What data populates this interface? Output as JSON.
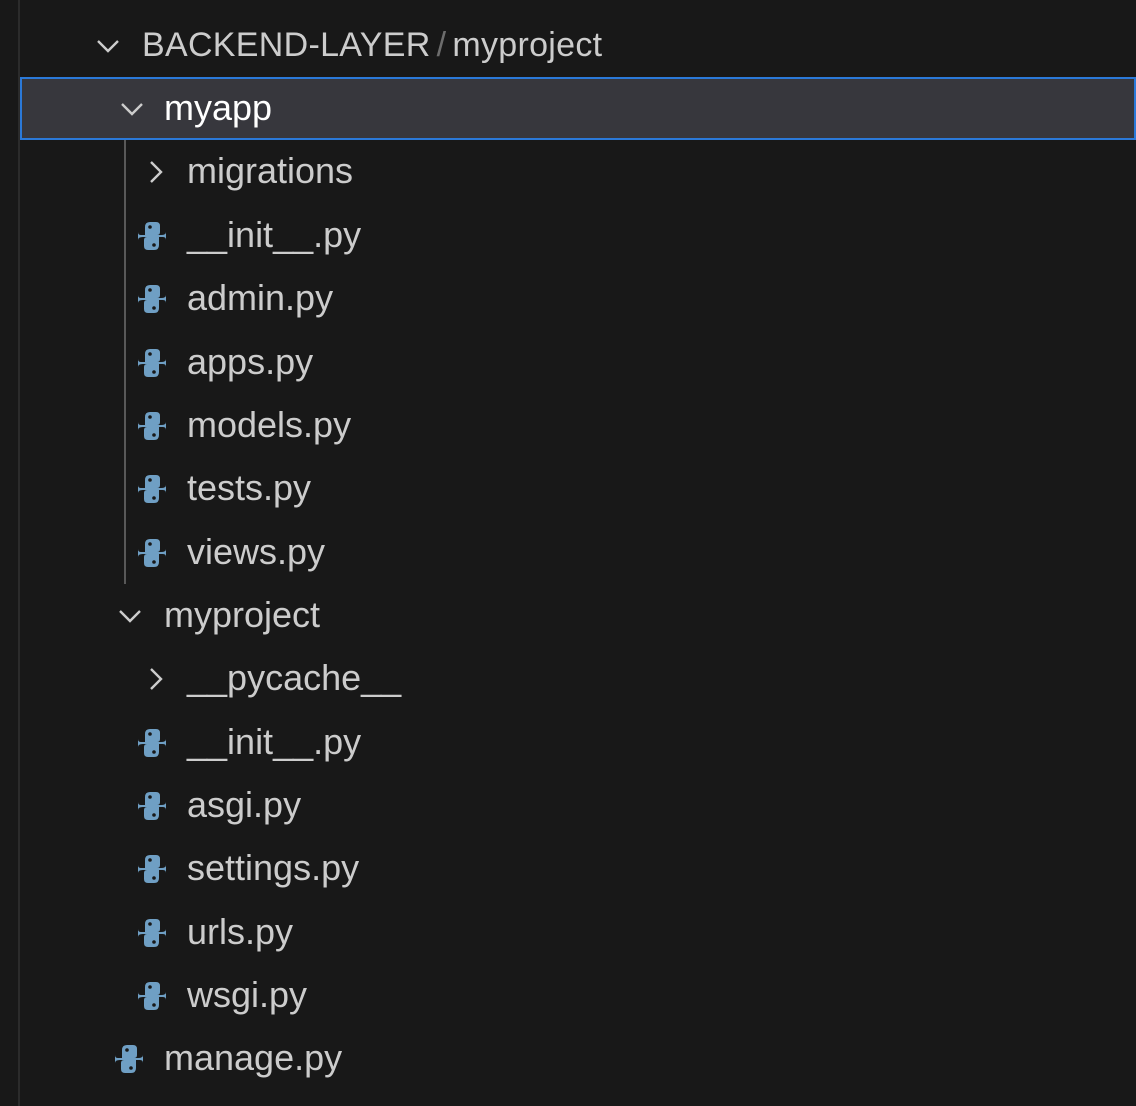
{
  "explorer": {
    "root": {
      "folder": "BACKEND-LAYER",
      "separator": "/",
      "subfolder": "myproject"
    },
    "tree": [
      {
        "label": "myapp",
        "kind": "folder",
        "expanded": true,
        "selected": true
      },
      {
        "label": "migrations",
        "kind": "folder",
        "expanded": false
      },
      {
        "label": "__init__.py",
        "kind": "python-file"
      },
      {
        "label": "admin.py",
        "kind": "python-file"
      },
      {
        "label": "apps.py",
        "kind": "python-file"
      },
      {
        "label": "models.py",
        "kind": "python-file"
      },
      {
        "label": "tests.py",
        "kind": "python-file"
      },
      {
        "label": "views.py",
        "kind": "python-file"
      },
      {
        "label": "myproject",
        "kind": "folder",
        "expanded": true
      },
      {
        "label": "__pycache__",
        "kind": "folder",
        "expanded": false
      },
      {
        "label": "__init__.py",
        "kind": "python-file"
      },
      {
        "label": "asgi.py",
        "kind": "python-file"
      },
      {
        "label": "settings.py",
        "kind": "python-file"
      },
      {
        "label": "urls.py",
        "kind": "python-file"
      },
      {
        "label": "wsgi.py",
        "kind": "python-file"
      },
      {
        "label": "manage.py",
        "kind": "python-file"
      }
    ]
  },
  "icons": {
    "folder_open": "chevron-down-icon",
    "folder_closed": "chevron-right-icon",
    "python_file": "python-icon"
  },
  "colors": {
    "background": "#181818",
    "selection_background": "#37373d",
    "selection_border": "#2b79d8",
    "text": "#cccccc",
    "python_icon": "#6f9fc4"
  }
}
